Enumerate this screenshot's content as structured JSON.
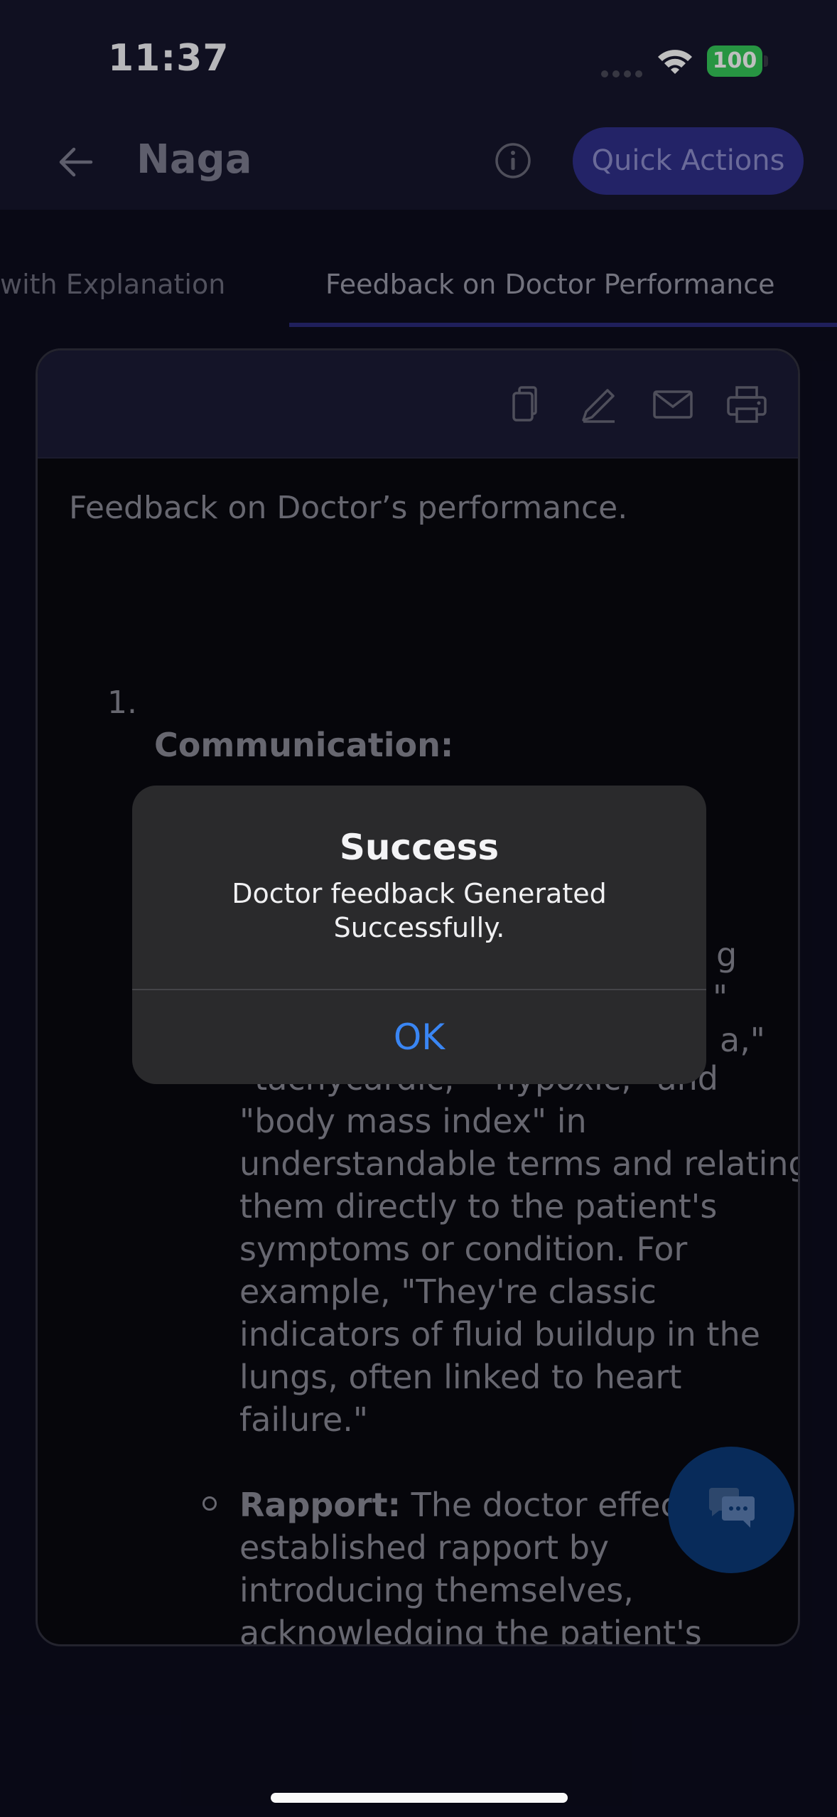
{
  "status_bar": {
    "time": "11:37",
    "battery": "100"
  },
  "header": {
    "title": "Naga",
    "quick_actions_label": "Quick Actions"
  },
  "tabs": [
    {
      "label": "with Explanation"
    },
    {
      "label": "Feedback on Doctor Performance"
    }
  ],
  "card": {
    "heading": "Feedback on Doctor’s performance.",
    "list_number": "1.",
    "section_title": "Communication:",
    "partial_lines": [
      "g",
      "\"",
      "a,\"",
      "\"tachycardic,\" \"hypoxic,\" and"
    ],
    "body_lines": [
      "\"body mass index\" in",
      "understandable terms and relating",
      "them directly to the patient's",
      "symptoms or condition. For",
      "example, \"They're classic",
      "indicators of fluid buildup in the",
      "lungs, often linked to heart",
      "failure.\""
    ],
    "rapport_label": "Rapport:",
    "rapport_lines": [
      " The doctor effecti",
      "established rapport by",
      "introducing themselves,",
      "acknowledging the patient's"
    ]
  },
  "alert": {
    "title": "Success",
    "message": "Doctor feedback Generated Successfully.",
    "ok_label": "OK"
  },
  "icons": {
    "back": "back-arrow-icon",
    "info": "info-icon",
    "copy": "copy-icon",
    "edit": "pencil-icon",
    "email": "mail-icon",
    "print": "printer-icon",
    "chat": "chat-icon"
  },
  "colors": {
    "accent": "#2f2f8a",
    "alert_button": "#3a86f4",
    "battery": "#34c759",
    "fab": "#0b3a78"
  }
}
